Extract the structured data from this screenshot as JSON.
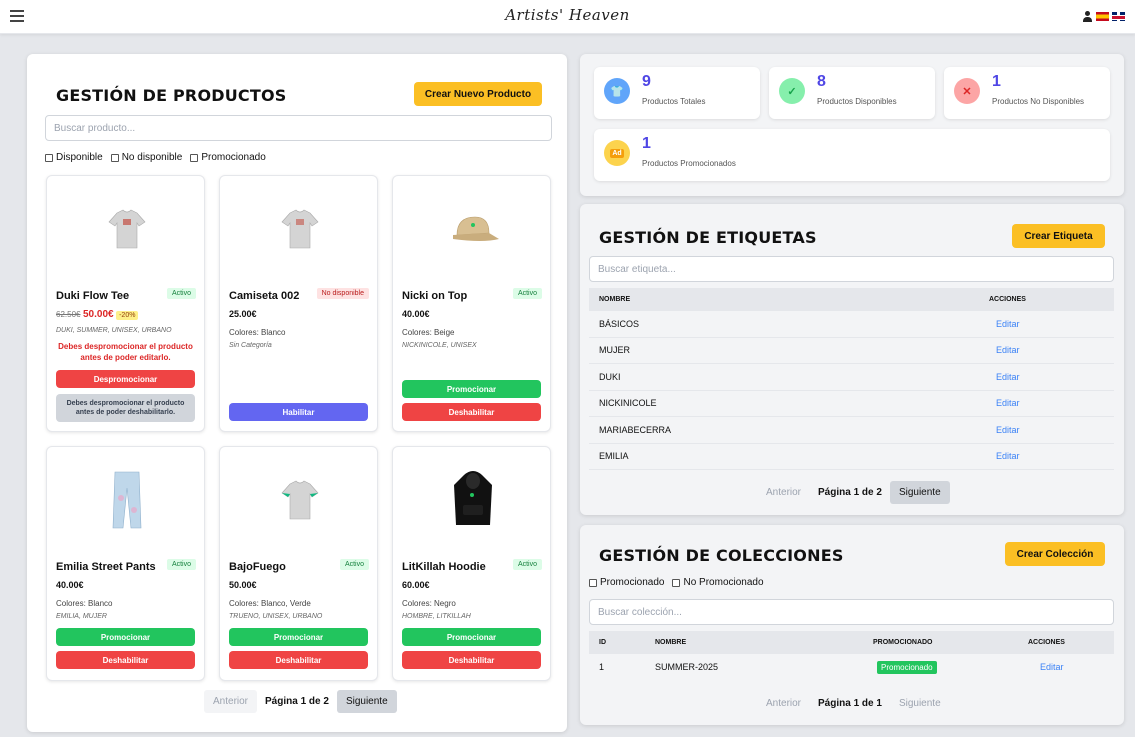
{
  "header": {
    "brand": "Artists' Heaven"
  },
  "products": {
    "title": "GESTIÓN DE PRODUCTOS",
    "create_label": "Crear Nuevo Producto",
    "search_placeholder": "Buscar producto...",
    "filters": [
      "Disponible",
      "No disponible",
      "Promocionado"
    ],
    "items": [
      {
        "name": "Duki Flow Tee",
        "status": "Activo",
        "old_price": "62.50€",
        "price": "50.00€",
        "discount": "-20%",
        "colors": "",
        "tags": "DUKI, SUMMER, UNISEX, URBANO",
        "warning": "Debes despromocionar el producto antes de poder editarlo.",
        "primary_action": "Despromocionar",
        "note": "Debes despromocionar el producto antes de poder deshabilitarlo."
      },
      {
        "name": "Camiseta 002",
        "status": "No disponible",
        "price": "25.00€",
        "colors": "Colores: Blanco",
        "tags": "Sin Categoría",
        "primary_action": "Habilitar"
      },
      {
        "name": "Nicki on Top",
        "status": "Activo",
        "price": "40.00€",
        "colors": "Colores: Beige",
        "tags": "NICKINICOLE, UNISEX",
        "primary_action": "Promocionar",
        "secondary_action": "Deshabilitar"
      },
      {
        "name": "Emilia Street Pants",
        "status": "Activo",
        "price": "40.00€",
        "colors": "Colores: Blanco",
        "tags": "EMILIA, MUJER",
        "primary_action": "Promocionar",
        "secondary_action": "Deshabilitar"
      },
      {
        "name": "BajoFuego",
        "status": "Activo",
        "price": "50.00€",
        "colors": "Colores: Blanco, Verde",
        "tags": "TRUENO, UNISEX, URBANO",
        "primary_action": "Promocionar",
        "secondary_action": "Deshabilitar"
      },
      {
        "name": "LitKillah Hoodie",
        "status": "Activo",
        "price": "60.00€",
        "colors": "Colores: Negro",
        "tags": "HOMBRE, LITKILLAH",
        "primary_action": "Promocionar",
        "secondary_action": "Deshabilitar"
      }
    ],
    "pager": {
      "prev": "Anterior",
      "info": "Página 1 de 2",
      "next": "Siguiente"
    }
  },
  "stats": [
    {
      "value": "9",
      "label": "Productos Totales"
    },
    {
      "value": "8",
      "label": "Productos Disponibles"
    },
    {
      "value": "1",
      "label": "Productos No Disponibles"
    },
    {
      "value": "1",
      "label": "Productos Promocionados"
    }
  ],
  "tags_panel": {
    "title": "GESTIÓN DE ETIQUETAS",
    "create_label": "Crear Etiqueta",
    "search_placeholder": "Buscar etiqueta...",
    "col_name": "NOMBRE",
    "col_actions": "ACCIONES",
    "edit": "Editar",
    "rows": [
      "BÁSICOS",
      "MUJER",
      "DUKI",
      "NICKINICOLE",
      "MARIABECERRA",
      "EMILIA"
    ],
    "pager": {
      "prev": "Anterior",
      "info": "Página 1 de 2",
      "next": "Siguiente"
    }
  },
  "collections": {
    "title": "GESTIÓN DE COLECCIONES",
    "create_label": "Crear Colección",
    "filters": [
      "Promocionado",
      "No Promocionado"
    ],
    "search_placeholder": "Buscar colección...",
    "cols": [
      "ID",
      "NOMBRE",
      "PROMOCIONADO",
      "ACCIONES"
    ],
    "rows": [
      {
        "id": "1",
        "name": "SUMMER-2025",
        "promoted": "Promocionado",
        "action": "Editar"
      }
    ],
    "pager": {
      "prev": "Anterior",
      "info": "Página 1 de 1",
      "next": "Siguiente"
    }
  }
}
